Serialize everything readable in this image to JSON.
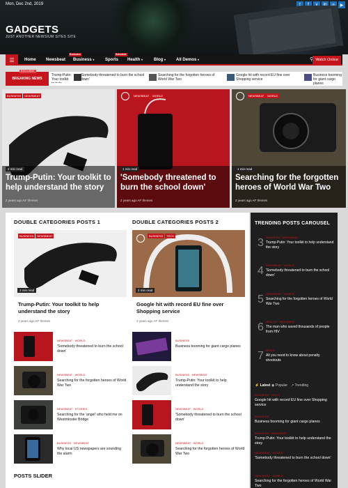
{
  "header": {
    "date": "Mon, Dec 2nd, 2019",
    "site_title": "GADGETS",
    "tagline": "JUST ANOTHER NEWSIUM SITES SITE",
    "social_icons": [
      "twitter-icon",
      "facebook-icon",
      "vk-icon",
      "linkedin-icon",
      "instagram-icon",
      "youtube-icon"
    ]
  },
  "nav": {
    "items": [
      "Home",
      "Newsbeat",
      "Business",
      "Sports",
      "Health",
      "Blog",
      "All Demos"
    ],
    "badges": {
      "business": "Exclusive",
      "sports": "Schedule"
    },
    "watch_label": "Watch Online"
  },
  "breaking": {
    "label": "BREAKING NEWS",
    "exclusive": "EXCLUSIVE",
    "items": [
      "Trump-Putin: Your toolkit to help understand the story",
      "'Somebody threatened to burn the school down'",
      "Searching for the forgotten heroes of World War Two",
      "Google hit with record EU fine over Shopping service",
      "Business booming for giant cargo planes"
    ]
  },
  "hero": [
    {
      "cats": [
        "BUSINESS",
        "NEWSBEAT"
      ],
      "read": "2 min read",
      "title": "Trump-Putin: Your toolkit to help understand the story",
      "meta": "2 years ago  AF themes"
    },
    {
      "cats": [
        "NEWSBEAT",
        "WORLD"
      ],
      "read": "1 min read",
      "title": "'Somebody threatened to burn the school down'",
      "meta": "2 years ago  AF themes"
    },
    {
      "cats": [
        "NEWSBEAT",
        "WORLD"
      ],
      "read": "1 min read",
      "title": "Searching for the forgotten heroes of World War Two",
      "meta": "2 years ago  AF themes"
    }
  ],
  "double1": {
    "title": "DOUBLE CATEGORIES POSTS 1",
    "cats": [
      "BUSINESS",
      "NEWSBEAT"
    ],
    "read": "2 min read",
    "big_title": "Trump-Putin: Your toolkit to help understand the story",
    "meta": "2 years ago  AF themes",
    "list": [
      {
        "cat": "NEWSBEAT · WORLD",
        "title": "'Somebody threatened to burn the school down'"
      },
      {
        "cat": "NEWSBEAT · WORLD",
        "title": "Searching for the forgotten heroes of World War Two"
      },
      {
        "cat": "NEWSBEAT · STORIES",
        "title": "Searching for the 'angel' who held me on Westminster Bridge"
      },
      {
        "cat": "BUSINESS · NEWSBEAT",
        "title": "Why local US newspapers are sounding the alarm"
      }
    ]
  },
  "double2": {
    "title": "DOUBLE CATEGORIES POSTS 2",
    "cats": [
      "BUSINESS",
      "TECH"
    ],
    "read": "2 min read",
    "big_title": "Google hit with record EU fine over Shopping service",
    "meta": "2 years ago  AF themes",
    "list": [
      {
        "cat": "BUSINESS",
        "title": "Business booming for giant cargo planes"
      },
      {
        "cat": "BUSINESS · NEWSBEAT",
        "title": "Trump-Putin: Your toolkit to help understand the story"
      },
      {
        "cat": "NEWSBEAT · WORLD",
        "title": "'Somebody threatened to burn the school down'"
      },
      {
        "cat": "NEWSBEAT · WORLD",
        "title": "Searching for the forgotten heroes of World War Two"
      }
    ]
  },
  "trending": {
    "title": "TRENDING POSTS CAROUSEL",
    "items": [
      {
        "num": "3",
        "cat": "BUSINESS · NEWSBEAT",
        "title": "Trump-Putin: Your toolkit to help understand the story"
      },
      {
        "num": "4",
        "cat": "NEWSBEAT · WORLD",
        "title": "'Somebody threatened to burn the school down'"
      },
      {
        "num": "5",
        "cat": "NEWSBEAT · WORLD",
        "title": "Searching for the forgotten heroes of World War Two"
      },
      {
        "num": "6",
        "cat": "HEALTH · NEWSBEAT",
        "title": "The man who saved thousands of people from HIV"
      },
      {
        "num": "7",
        "cat": "NEWS",
        "title": "All you need to know about penalty shootouts"
      }
    ],
    "tabs": [
      "Latest",
      "Popular",
      "Trending"
    ],
    "latest": [
      {
        "cat": "BUSINESS · TECH",
        "title": "Google hit with record EU fine over Shopping service"
      },
      {
        "cat": "BUSINESS",
        "title": "Business booming for giant cargo planes"
      },
      {
        "cat": "BUSINESS · NEWSBEAT",
        "title": "Trump-Putin: Your toolkit to help understand the story"
      },
      {
        "cat": "NEWSBEAT · WORLD",
        "title": "'Somebody threatened to burn the school down'"
      },
      {
        "cat": "NEWSBEAT · WORLD",
        "title": "Searching for the forgotten heroes of World War Two"
      }
    ]
  },
  "slider": {
    "title": "POSTS SLIDER"
  },
  "colors": {
    "accent": "#c5141c",
    "dark": "#1e1e1e"
  }
}
